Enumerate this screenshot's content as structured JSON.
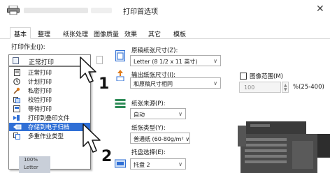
{
  "window": {
    "title": "打印首选项",
    "close_glyph": "✕"
  },
  "tabs": [
    {
      "label": "基本"
    },
    {
      "label": "整理"
    },
    {
      "label": "纸张处理"
    },
    {
      "label": "图像质量"
    },
    {
      "label": "效果"
    },
    {
      "label": "其它"
    },
    {
      "label": "模板"
    }
  ],
  "print_job": {
    "label": "打印作业(J):",
    "selected": "正常打印",
    "options": [
      {
        "label": "正常打印",
        "icon": "document-icon"
      },
      {
        "label": "计划打印",
        "icon": "clock-icon"
      },
      {
        "label": "私密打印",
        "icon": "key-icon"
      },
      {
        "label": "校验打印",
        "icon": "proof-icon"
      },
      {
        "label": "等待打印",
        "icon": "hold-icon"
      },
      {
        "label": "打印到叠印文件",
        "icon": "overlay-arrow-icon"
      },
      {
        "label": "存储到电子归档",
        "icon": "e-filing-icon",
        "highlighted": true
      },
      {
        "label": "多重作业类型",
        "icon": "multi-job-icon"
      }
    ]
  },
  "preview": {
    "line1": "100%",
    "line2": "Letter"
  },
  "callouts": {
    "first": "1",
    "second": "2"
  },
  "original_paper": {
    "label": "原稿纸张尺寸(Z):",
    "value": "Letter (8 1/2 x 11 英寸)"
  },
  "output_paper": {
    "label": "输出纸张尺寸(I):",
    "value": "和原稿尺寸相同"
  },
  "zoom": {
    "checkbox_label": "图像范围(M)",
    "value": "100",
    "range": "%(25-400)"
  },
  "paper_source": {
    "label": "纸张来源(P):",
    "value": "自动"
  },
  "paper_type": {
    "label": "纸张类型(Y):",
    "value": "普通纸 (60-80g/m² ∨"
  },
  "tray": {
    "label": "托盘选择(E):",
    "value": "托盘 2"
  },
  "colors": {
    "highlight": "#2f6fd6",
    "accent_orange": "#e07b1a"
  }
}
